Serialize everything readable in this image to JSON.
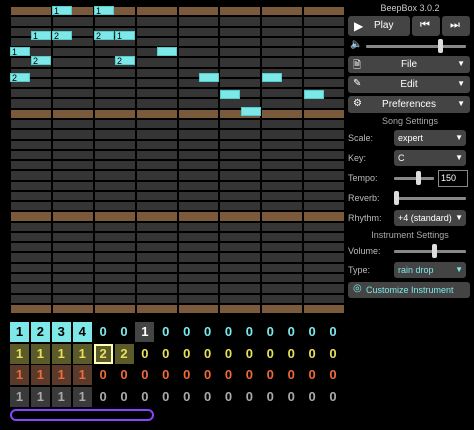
{
  "app_title": "BeepBox 3.0.2",
  "transport": {
    "play_label": "Play",
    "play_icon": "play-icon",
    "prev_icon": "skip-back-icon",
    "next_icon": "skip-forward-icon"
  },
  "menus": {
    "file": "File",
    "edit": "Edit",
    "preferences": "Preferences"
  },
  "song_settings": {
    "title": "Song Settings",
    "scale_label": "Scale:",
    "scale_value": "expert",
    "key_label": "Key:",
    "key_value": "C",
    "tempo_label": "Tempo:",
    "tempo_value": "150",
    "reverb_label": "Reverb:",
    "rhythm_label": "Rhythm:",
    "rhythm_value": "+4 (standard)"
  },
  "instrument_settings": {
    "title": "Instrument Settings",
    "volume_label": "Volume:",
    "type_label": "Type:",
    "type_value": "rain drop",
    "customize_label": "Customize Instrument"
  },
  "notes": [
    {
      "label": "1"
    },
    {
      "label": "1"
    },
    {
      "label": "1"
    },
    {
      "label": "2"
    },
    {
      "label": "2"
    },
    {
      "label": "1"
    },
    {
      "label": "1"
    },
    {
      "label": "2"
    },
    {
      "label": "2"
    },
    {
      "label": "2"
    }
  ],
  "pattern_rows": [
    {
      "color": "#7ee8e8",
      "cells": [
        "1",
        "2",
        "3",
        "4",
        "0",
        "0",
        "1",
        "0",
        "0",
        "0",
        "0",
        "0",
        "0",
        "0",
        "0",
        "0"
      ]
    },
    {
      "color": "#e8e05a",
      "cells": [
        "1",
        "1",
        "1",
        "1",
        "2",
        "2",
        "0",
        "0",
        "0",
        "0",
        "0",
        "0",
        "0",
        "0",
        "0",
        "0"
      ]
    },
    {
      "color": "#f06a3a",
      "cells": [
        "1",
        "1",
        "1",
        "1",
        "0",
        "0",
        "0",
        "0",
        "0",
        "0",
        "0",
        "0",
        "0",
        "0",
        "0",
        "0"
      ]
    },
    {
      "color": "#aaaaaa",
      "cells": [
        "1",
        "1",
        "1",
        "1",
        "0",
        "0",
        "0",
        "0",
        "0",
        "0",
        "0",
        "0",
        "0",
        "0",
        "0",
        "0"
      ]
    }
  ]
}
